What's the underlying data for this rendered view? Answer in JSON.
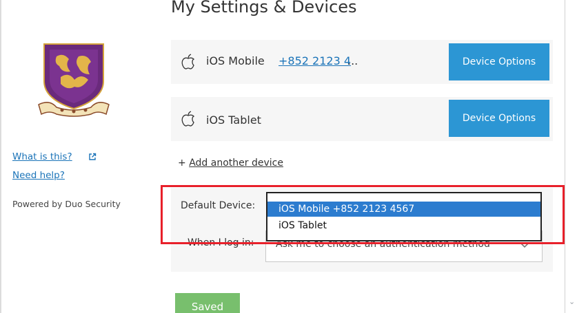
{
  "page": {
    "title": "My Settings & Devices"
  },
  "sidebar": {
    "logo_icon": "university-crest-icon",
    "what_is_this": "What is this?",
    "need_help": "Need help?",
    "powered_by": "Powered by Duo Security"
  },
  "devices": [
    {
      "icon": "apple-icon",
      "name": "iOS Mobile",
      "phone": "+852 2123 4",
      "ellipsis": "...",
      "button": "Device Options"
    },
    {
      "icon": "apple-icon",
      "name": "iOS Tablet",
      "button": "Device Options"
    }
  ],
  "add_device": {
    "prefix": "+ ",
    "label": "Add another device"
  },
  "settings": {
    "default_device_label": "Default Device:",
    "default_device_options": [
      "iOS Mobile +852 2123 4567",
      "iOS Tablet"
    ],
    "default_device_selected": "iOS Mobile +852 2123 4567",
    "when_login_label": "When I log in:",
    "when_login_value": "Ask me to choose an authentication method"
  },
  "saved_button": "Saved",
  "colors": {
    "accent": "#2c96d4",
    "link": "#1a73b8",
    "saved": "#78bf6d",
    "highlight": "#e8202a",
    "dropdown_selected": "#2c7ccf"
  }
}
